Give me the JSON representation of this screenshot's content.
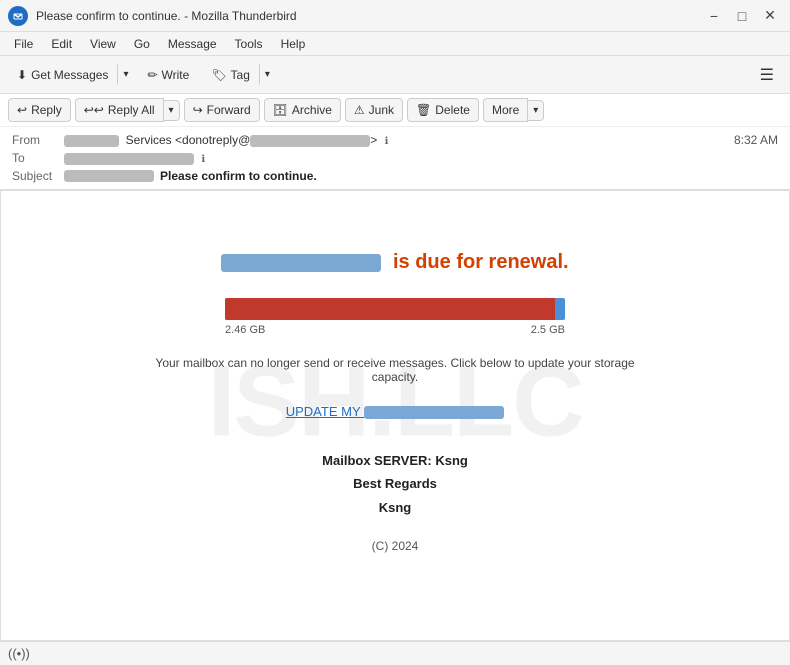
{
  "window": {
    "title": "Please confirm to continue. - Mozilla Thunderbird"
  },
  "titlebar": {
    "app_icon": "TB",
    "minimize_label": "−",
    "maximize_label": "□",
    "close_label": "✕"
  },
  "menubar": {
    "items": [
      {
        "label": "File"
      },
      {
        "label": "Edit"
      },
      {
        "label": "View"
      },
      {
        "label": "Go"
      },
      {
        "label": "Message"
      },
      {
        "label": "Tools"
      },
      {
        "label": "Help"
      }
    ]
  },
  "toolbar": {
    "get_messages_label": "Get Messages",
    "write_label": "Write",
    "tag_label": "Tag"
  },
  "action_bar": {
    "reply_label": "Reply",
    "reply_all_label": "Reply All",
    "forward_label": "Forward",
    "archive_label": "Archive",
    "junk_label": "Junk",
    "delete_label": "Delete",
    "more_label": "More"
  },
  "email": {
    "from_label": "From",
    "from_name_blurred_width": "55",
    "from_services": "Services <donotreply@",
    "from_blurred_width": "120",
    "to_label": "To",
    "to_blurred_width": "130",
    "time": "8:32 AM",
    "subject_label": "Subject",
    "subject_blurred_width": "90",
    "subject_text": "Please confirm to continue."
  },
  "body": {
    "heading_blurred_width": "160",
    "heading_text": "is due for renewal.",
    "storage_used": "2.46 GB",
    "storage_total": "2.5 GB",
    "storage_fill_percent": "97",
    "message": "Your mailbox can no longer send or receive messages. Click below to update your storage capacity.",
    "update_prefix": "UPDATE MY",
    "update_blurred_width": "140",
    "signature_line1": "Mailbox SERVER: Ksng",
    "signature_line2": "Best Regards",
    "signature_line3": "Ksng",
    "copyright": "(C) 2024"
  },
  "statusbar": {
    "wifi_icon": "((•))"
  }
}
